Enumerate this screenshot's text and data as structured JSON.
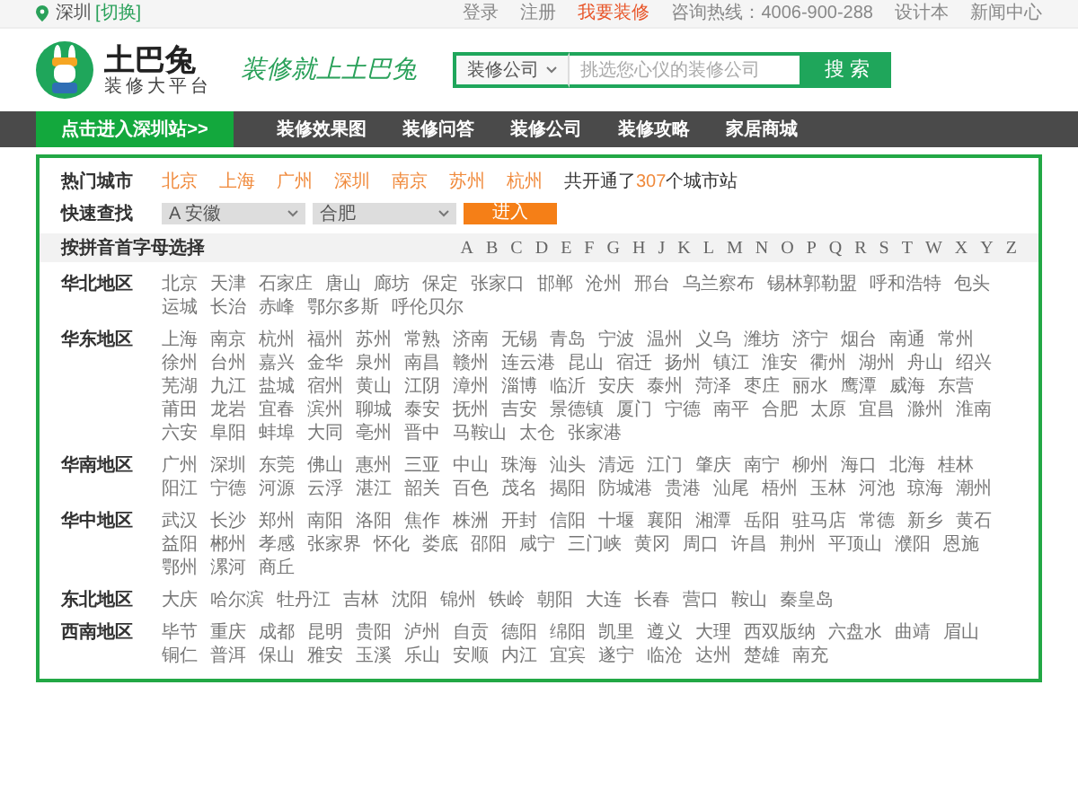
{
  "top_bar": {
    "city": "深圳",
    "switch": "[切换]",
    "links": [
      {
        "label": "登录",
        "highlight": false
      },
      {
        "label": "注册",
        "highlight": false
      },
      {
        "label": "我要装修",
        "highlight": true
      },
      {
        "label": "咨询热线：4006-900-288",
        "highlight": false
      },
      {
        "label": "设计本",
        "highlight": false
      },
      {
        "label": "新闻中心",
        "highlight": false
      }
    ]
  },
  "header": {
    "logo": "土巴兔",
    "tagline": "装修大平台",
    "slogan": "装修就上土巴兔",
    "search": {
      "category": "装修公司",
      "placeholder": "挑选您心仪的装修公司",
      "button": "搜 索"
    }
  },
  "nav": {
    "city_button": "点击进入深圳站>>",
    "items": [
      "装修效果图",
      "装修问答",
      "装修公司",
      "装修攻略",
      "家居商城"
    ]
  },
  "hot_cities": {
    "label": "热门城市",
    "cities": [
      "北京",
      "上海",
      "广州",
      "深圳",
      "南京",
      "苏州",
      "杭州"
    ],
    "count_prefix": "共开通了",
    "count": "307",
    "count_suffix": "个城市站"
  },
  "quick_find": {
    "label": "快速查找",
    "province": "A 安徽",
    "city": "合肥",
    "button": "进入"
  },
  "pinyin": {
    "label": "按拼音首字母选择",
    "letters": [
      "A",
      "B",
      "C",
      "D",
      "E",
      "F",
      "G",
      "H",
      "J",
      "K",
      "L",
      "M",
      "N",
      "O",
      "P",
      "Q",
      "R",
      "S",
      "T",
      "W",
      "X",
      "Y",
      "Z"
    ]
  },
  "regions": [
    {
      "name": "华北地区",
      "cities": [
        "北京",
        "天津",
        "石家庄",
        "唐山",
        "廊坊",
        "保定",
        "张家口",
        "邯郸",
        "沧州",
        "邢台",
        "乌兰察布",
        "锡林郭勒盟",
        "呼和浩特",
        "包头",
        "运城",
        "长治",
        "赤峰",
        "鄂尔多斯",
        "呼伦贝尔"
      ]
    },
    {
      "name": "华东地区",
      "cities": [
        "上海",
        "南京",
        "杭州",
        "福州",
        "苏州",
        "常熟",
        "济南",
        "无锡",
        "青岛",
        "宁波",
        "温州",
        "义乌",
        "潍坊",
        "济宁",
        "烟台",
        "南通",
        "常州",
        "徐州",
        "台州",
        "嘉兴",
        "金华",
        "泉州",
        "南昌",
        "赣州",
        "连云港",
        "昆山",
        "宿迁",
        "扬州",
        "镇江",
        "淮安",
        "衢州",
        "湖州",
        "舟山",
        "绍兴",
        "芜湖",
        "九江",
        "盐城",
        "宿州",
        "黄山",
        "江阴",
        "漳州",
        "淄博",
        "临沂",
        "安庆",
        "泰州",
        "菏泽",
        "枣庄",
        "丽水",
        "鹰潭",
        "威海",
        "东营",
        "莆田",
        "龙岩",
        "宜春",
        "滨州",
        "聊城",
        "泰安",
        "抚州",
        "吉安",
        "景德镇",
        "厦门",
        "宁德",
        "南平",
        "合肥",
        "太原",
        "宜昌",
        "滁州",
        "淮南",
        "六安",
        "阜阳",
        "蚌埠",
        "大同",
        "亳州",
        "晋中",
        "马鞍山",
        "太仓",
        "张家港"
      ]
    },
    {
      "name": "华南地区",
      "cities": [
        "广州",
        "深圳",
        "东莞",
        "佛山",
        "惠州",
        "三亚",
        "中山",
        "珠海",
        "汕头",
        "清远",
        "江门",
        "肇庆",
        "南宁",
        "柳州",
        "海口",
        "北海",
        "桂林",
        "阳江",
        "宁德",
        "河源",
        "云浮",
        "湛江",
        "韶关",
        "百色",
        "茂名",
        "揭阳",
        "防城港",
        "贵港",
        "汕尾",
        "梧州",
        "玉林",
        "河池",
        "琼海",
        "潮州"
      ]
    },
    {
      "name": "华中地区",
      "cities": [
        "武汉",
        "长沙",
        "郑州",
        "南阳",
        "洛阳",
        "焦作",
        "株洲",
        "开封",
        "信阳",
        "十堰",
        "襄阳",
        "湘潭",
        "岳阳",
        "驻马店",
        "常德",
        "新乡",
        "黄石",
        "益阳",
        "郴州",
        "孝感",
        "张家界",
        "怀化",
        "娄底",
        "邵阳",
        "咸宁",
        "三门峡",
        "黄冈",
        "周口",
        "许昌",
        "荆州",
        "平顶山",
        "濮阳",
        "恩施",
        "鄂州",
        "漯河",
        "商丘"
      ]
    },
    {
      "name": "东北地区",
      "cities": [
        "大庆",
        "哈尔滨",
        "牡丹江",
        "吉林",
        "沈阳",
        "锦州",
        "铁岭",
        "朝阳",
        "大连",
        "长春",
        "营口",
        "鞍山",
        "秦皇岛"
      ]
    },
    {
      "name": "西南地区",
      "cities": [
        "毕节",
        "重庆",
        "成都",
        "昆明",
        "贵阳",
        "泸州",
        "自贡",
        "德阳",
        "绵阳",
        "凯里",
        "遵义",
        "大理",
        "西双版纳",
        "六盘水",
        "曲靖",
        "眉山",
        "铜仁",
        "普洱",
        "保山",
        "雅安",
        "玉溪",
        "乐山",
        "安顺",
        "内江",
        "宜宾",
        "遂宁",
        "临沧",
        "达州",
        "楚雄",
        "南充"
      ]
    }
  ]
}
